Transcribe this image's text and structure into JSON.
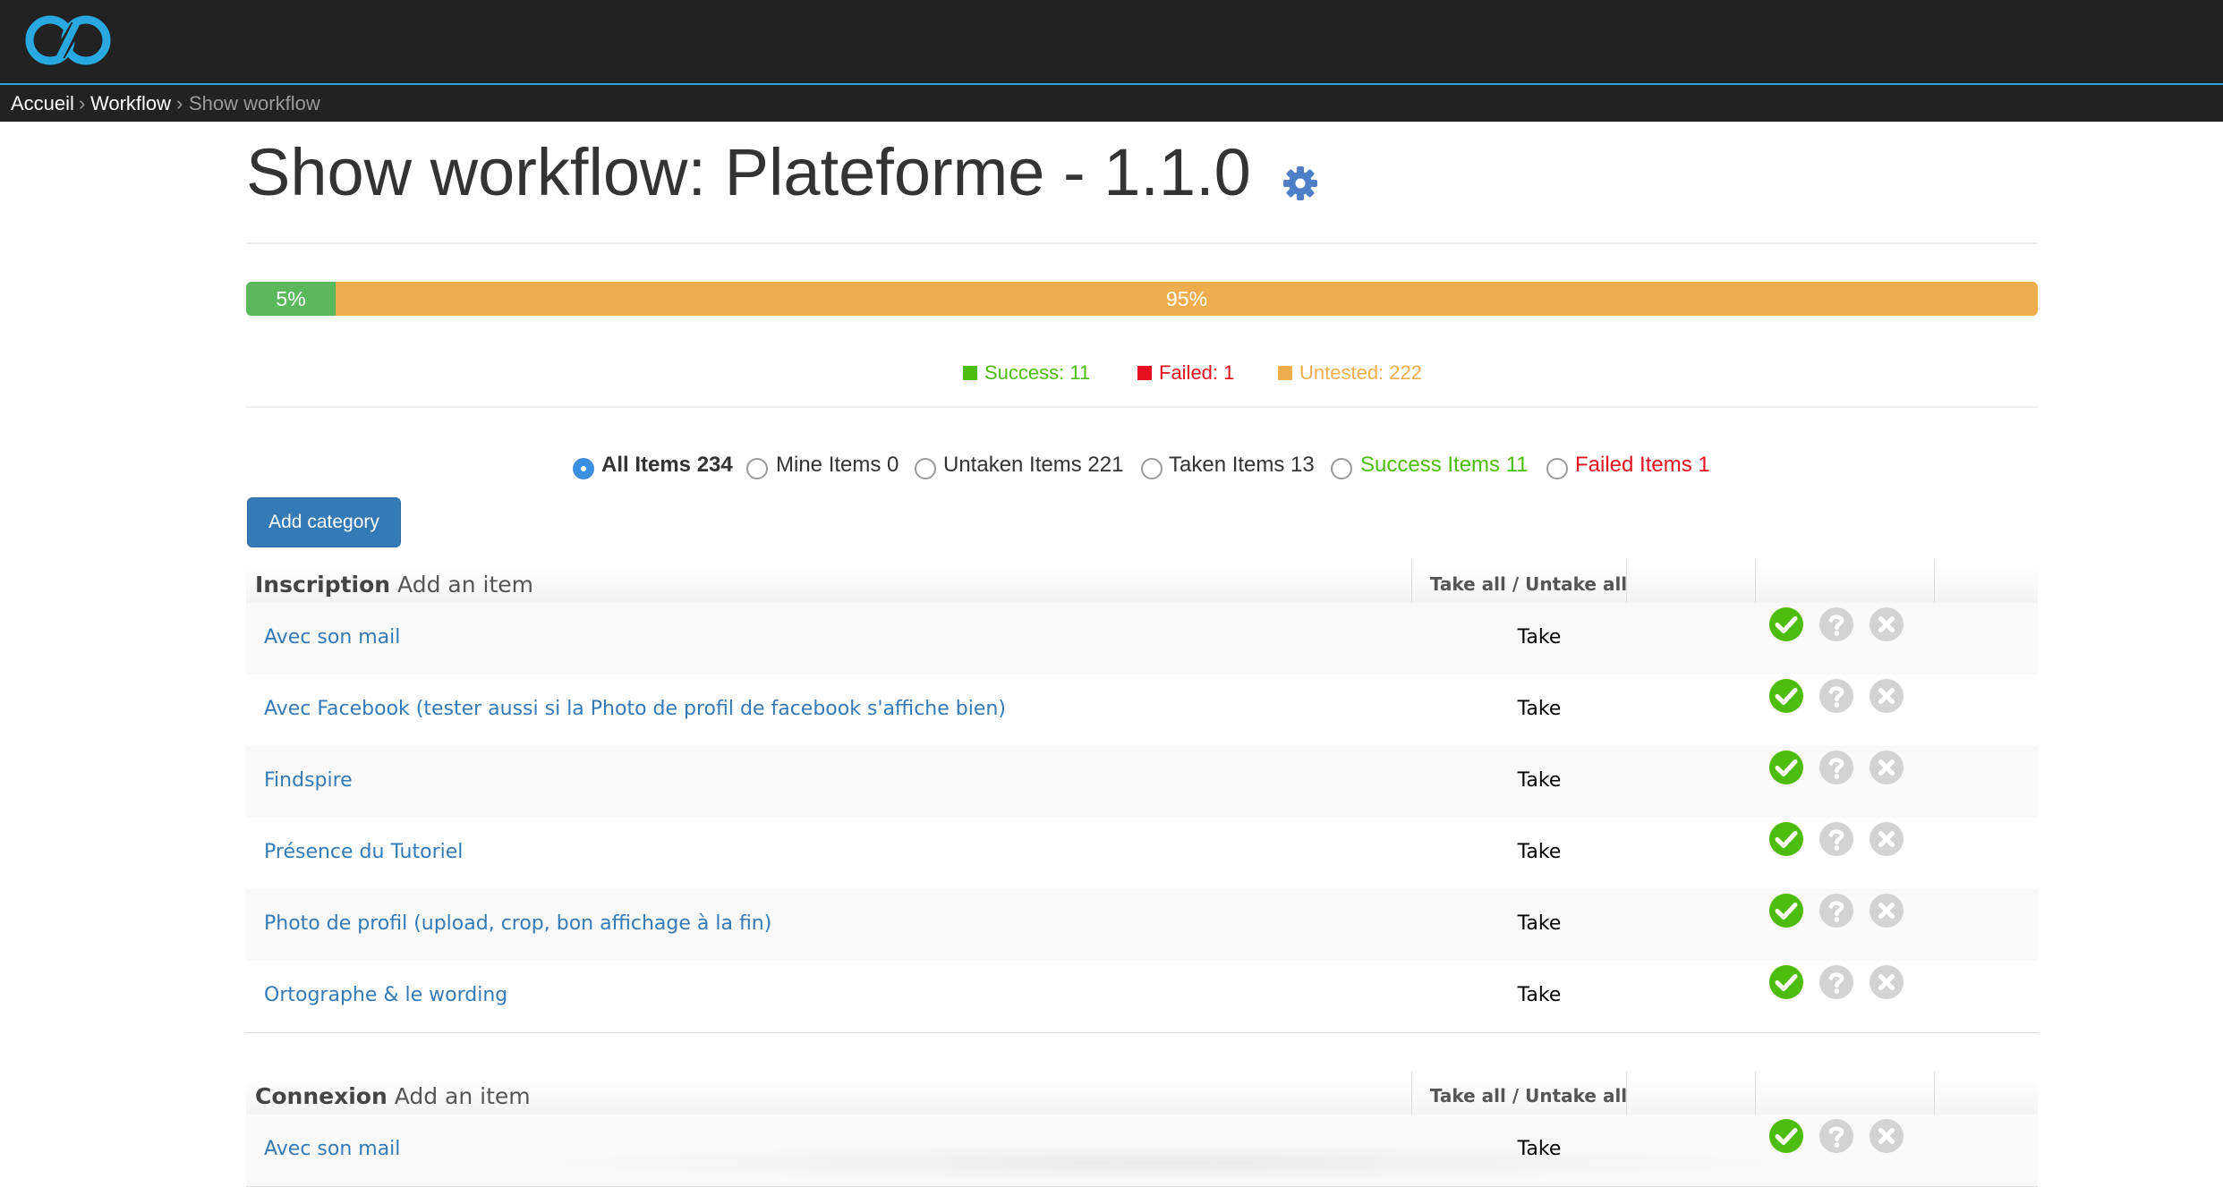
{
  "breadcrumb": {
    "home": "Accueil",
    "separator": "›",
    "workflow": "Workflow",
    "current": "Show workflow"
  },
  "page": {
    "title": "Show workflow: Plateforme - 1.1.0"
  },
  "progress": {
    "success_pct": 5,
    "success_label": "5%",
    "untested_pct": 95,
    "untested_label": "95%"
  },
  "legend": {
    "success": "Success: 11",
    "failed": "Failed: 1",
    "untested": "Untested: 222"
  },
  "filters": [
    {
      "label": "All Items 234",
      "checked": true
    },
    {
      "label": "Mine Items 0",
      "checked": false
    },
    {
      "label": "Untaken Items 221",
      "checked": false
    },
    {
      "label": "Taken Items 13",
      "checked": false
    },
    {
      "label": "Success Items 11",
      "checked": false
    },
    {
      "label": "Failed Items 1",
      "checked": false
    }
  ],
  "add_category_label": "Add category",
  "categories": [
    {
      "name": "Inscription",
      "add_item": "Add an item",
      "take_all_label": "Take all / Untake all",
      "items": [
        {
          "label": "Avec son mail",
          "action": "Take"
        },
        {
          "label": "Avec Facebook (tester aussi si la Photo de profil de facebook s'affiche bien)",
          "action": "Take"
        },
        {
          "label": "Findspire",
          "action": "Take"
        },
        {
          "label": "Présence du Tutoriel",
          "action": "Take"
        },
        {
          "label": "Photo de profil (upload, crop, bon affichage à la fin)",
          "action": "Take"
        },
        {
          "label": "Ortographe & le wording",
          "action": "Take"
        }
      ]
    },
    {
      "name": "Connexion",
      "add_item": "Add an item",
      "take_all_label": "Take all / Untake all",
      "items": [
        {
          "label": "Avec son mail",
          "action": "Take"
        }
      ]
    }
  ],
  "colors": {
    "navbar": "#222222",
    "accent": "#29a8e0",
    "success": "#5cb85c",
    "untested": "#f0ad4e",
    "failed": "#e8101f",
    "link": "#337ab7",
    "legend_success": "#4cbd0c",
    "legend_untested": "#f0ad4e"
  },
  "icons": {
    "logo": "infinity-logo-icon",
    "gear": "gear-icon",
    "success_status": "check-circle-icon",
    "untested_status": "question-circle-icon",
    "failed_status": "times-circle-icon"
  }
}
